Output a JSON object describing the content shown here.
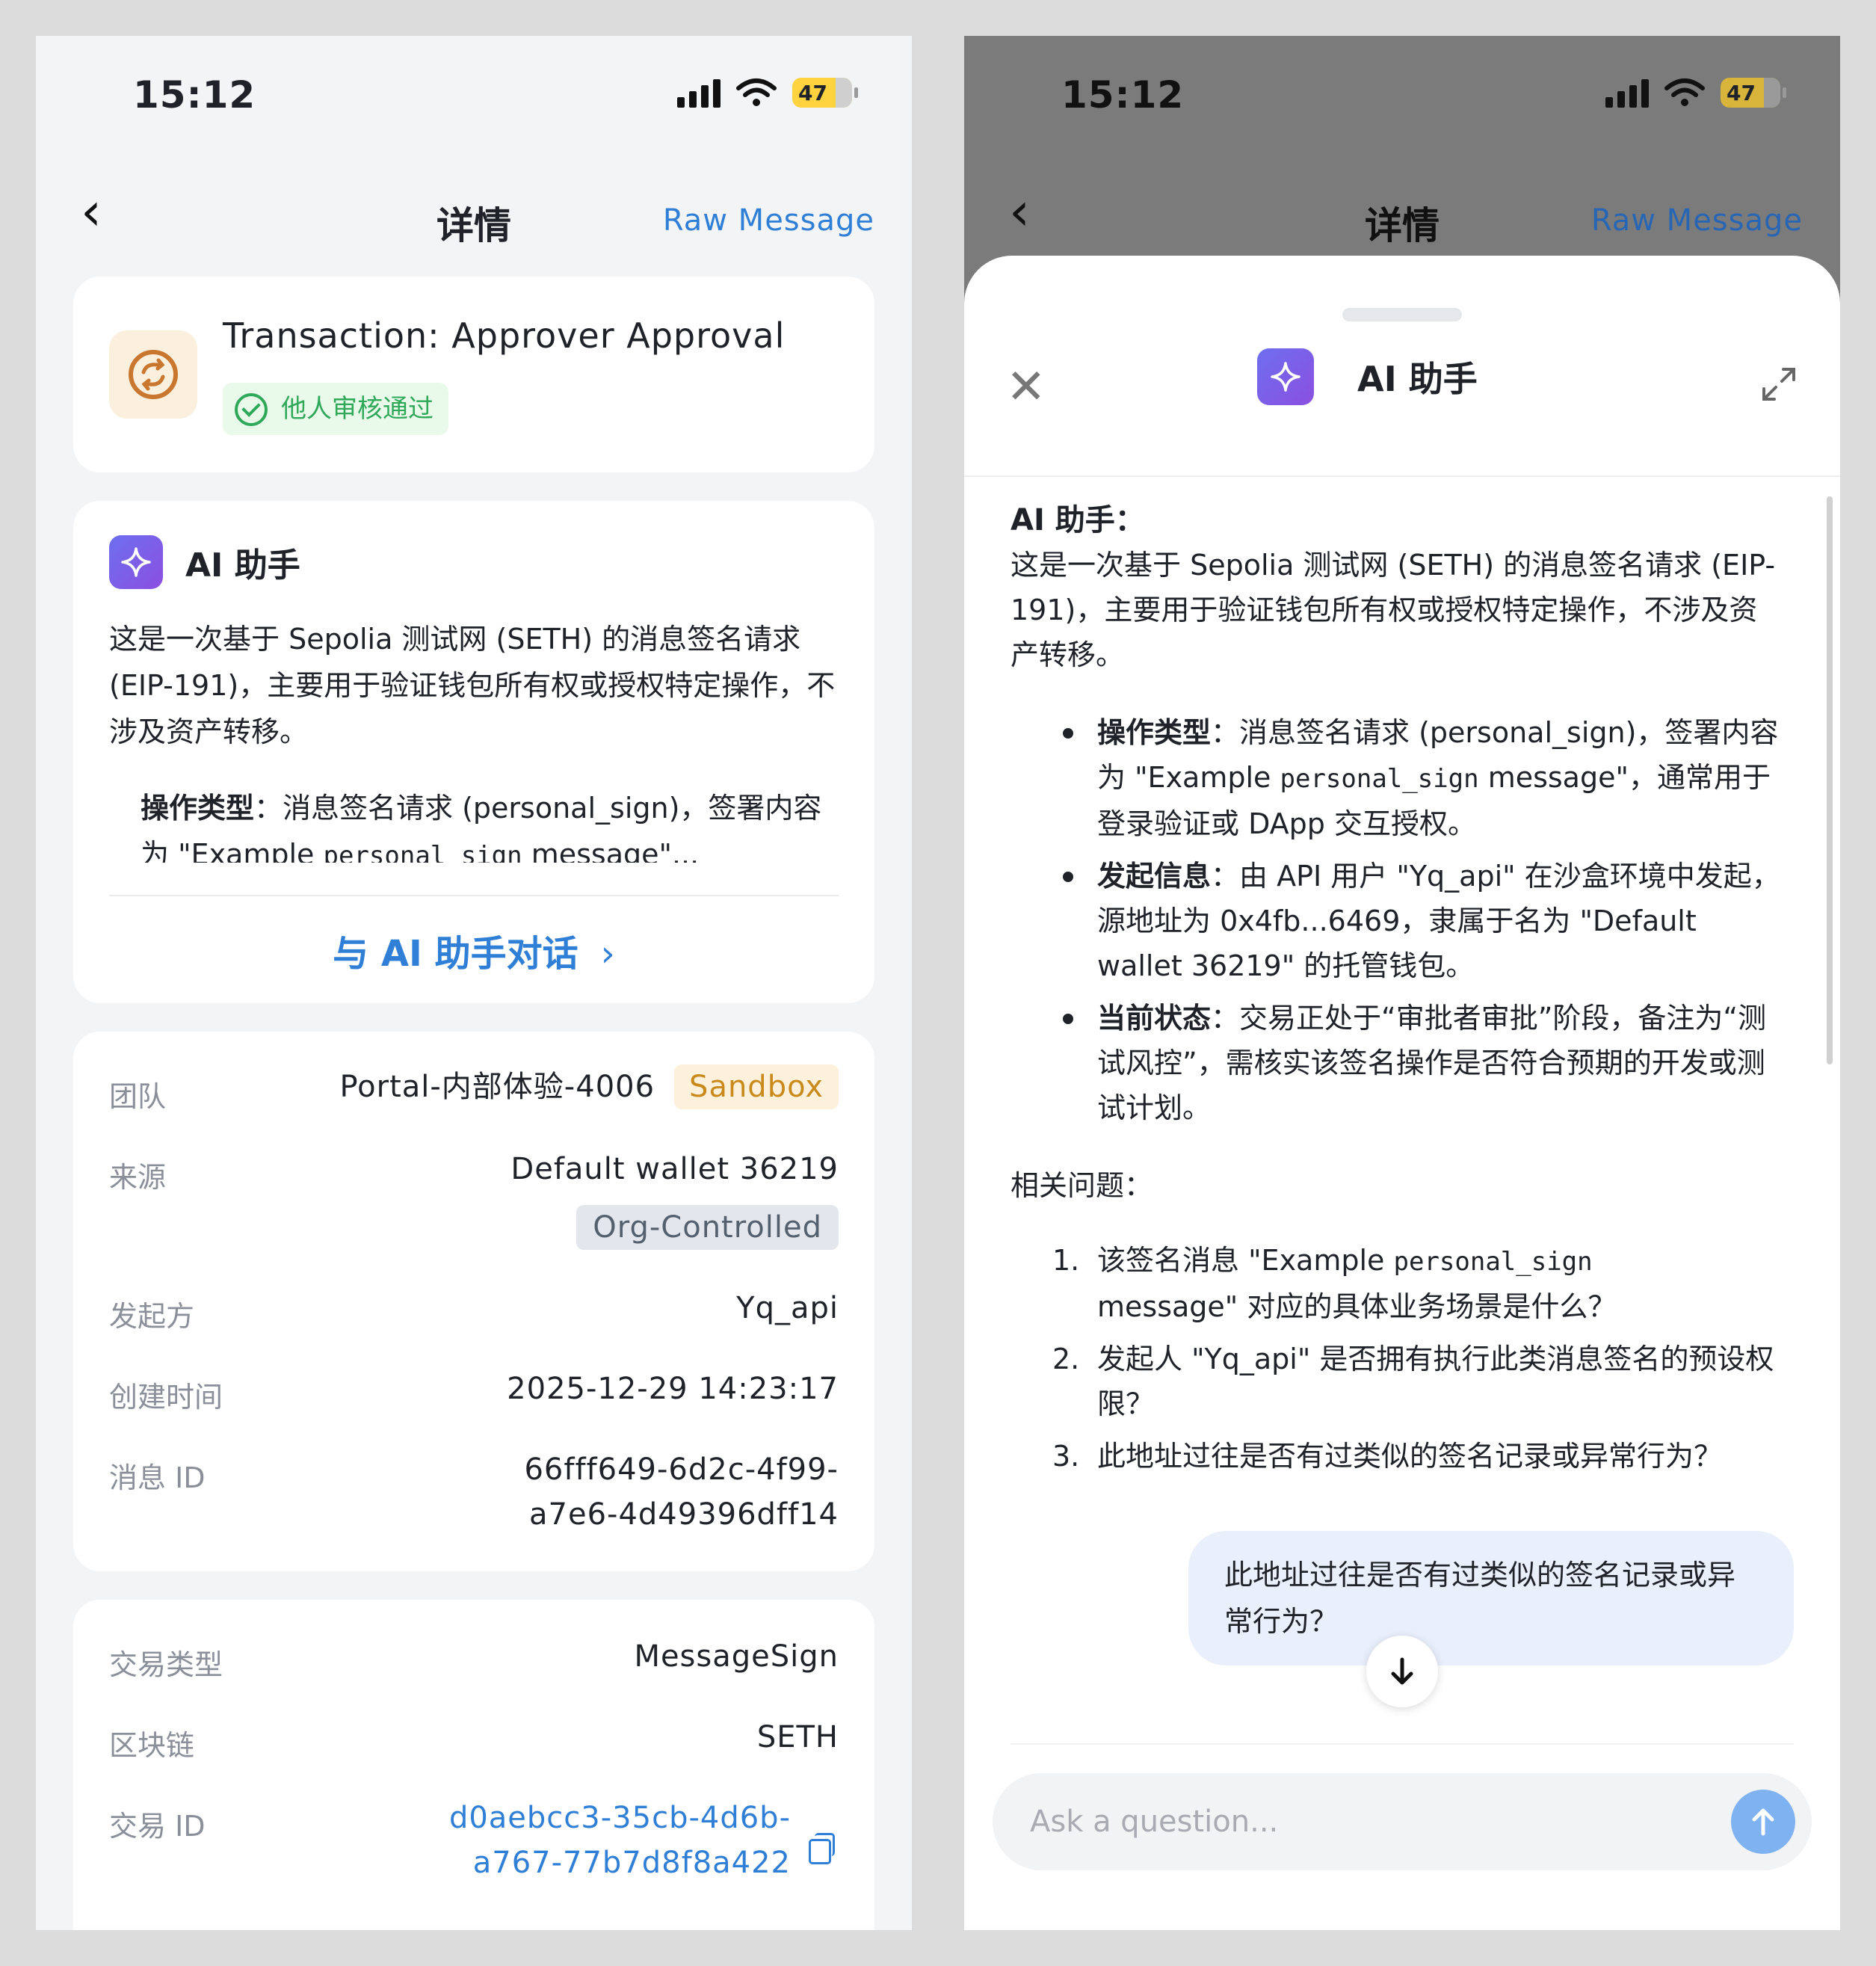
{
  "status": {
    "time": "15:12",
    "battery": "47"
  },
  "nav": {
    "title": "详情",
    "raw_message": "Raw Message"
  },
  "transaction": {
    "title": "Transaction: Approver Approval",
    "status_badge": "他人审核通过"
  },
  "ai_card": {
    "title": "AI 助手",
    "summary": "这是一次基于 Sepolia 测试网 (SETH) 的消息签名请求 (EIP-191)，主要用于验证钱包所有权或授权特定操作，不涉及资产转移。",
    "bullet_label": "操作类型",
    "bullet_text": "：消息签名请求 (personal_sign)，签署内容为 \"Example",
    "bullet_code": "personal_sign",
    "bullet_tail": "message\"...",
    "chat_link": "与 AI 助手对话"
  },
  "info": {
    "team_label": "团队",
    "team_value": "Portal-内部体验-4006",
    "team_tag": "Sandbox",
    "source_label": "来源",
    "source_value": "Default wallet 36219",
    "source_tag": "Org-Controlled",
    "initiator_label": "发起方",
    "initiator_value": "Yq_api",
    "created_label": "创建时间",
    "created_value": "2025-12-29 14:23:17",
    "msgid_label": "消息 ID",
    "msgid_line1": "66fff649-6d2c-4f99-",
    "msgid_line2": "a7e6-4d49396dff14"
  },
  "tx": {
    "type_label": "交易类型",
    "type_value": "MessageSign",
    "chain_label": "区块链",
    "chain_value": "SETH",
    "txid_label": "交易 ID",
    "txid_line1": "d0aebcc3-35cb-4d6b-",
    "txid_line2": "a767-77b7d8f8a422"
  },
  "sheet": {
    "title": "AI 助手",
    "heading": "AI 助手：",
    "intro": "这是一次基于 Sepolia 测试网 (SETH) 的消息签名请求 (EIP-191)，主要用于验证钱包所有权或授权特定操作，不涉及资产转移。",
    "bullets": [
      {
        "label": "操作类型",
        "pre": "：消息签名请求 (personal_sign)，签署内容为 \"Example ",
        "code": "personal_sign",
        "post": " message\"，通常用于登录验证或 DApp 交互授权。"
      },
      {
        "label": "发起信息",
        "pre": "：由 API 用户 \"Yq_api\" 在沙盒环境中发起，源地址为 0x4fb...6469，隶属于名为 \"Default wallet 36219\" 的托管钱包。",
        "code": "",
        "post": ""
      },
      {
        "label": "当前状态",
        "pre": "：交易正处于“审批者审批”阶段，备注为“测试风控”，需核实该签名操作是否符合预期的开发或测试计划。",
        "code": "",
        "post": ""
      }
    ],
    "related_heading": "相关问题：",
    "questions": [
      {
        "num": "1.",
        "pre": "该签名消息 \"Example ",
        "code": "personal_sign",
        "post": " message\" 对应的具体业务场景是什么？"
      },
      {
        "num": "2.",
        "pre": "发起人 \"Yq_api\" 是否拥有执行此类消息签名的预设权限？",
        "code": "",
        "post": ""
      },
      {
        "num": "3.",
        "pre": "此地址过往是否有过类似的签名记录或异常行为？",
        "code": "",
        "post": ""
      }
    ],
    "user_message": "此地址过往是否有过类似的签名记录或异常行为？",
    "input_placeholder": "Ask a question..."
  },
  "colors": {
    "accent": "#2f7fd6",
    "success": "#2fa85a",
    "sandbox": "#c98a1b",
    "ai_gradient_start": "#6e6ff0",
    "ai_gradient_end": "#8b4fe0"
  }
}
